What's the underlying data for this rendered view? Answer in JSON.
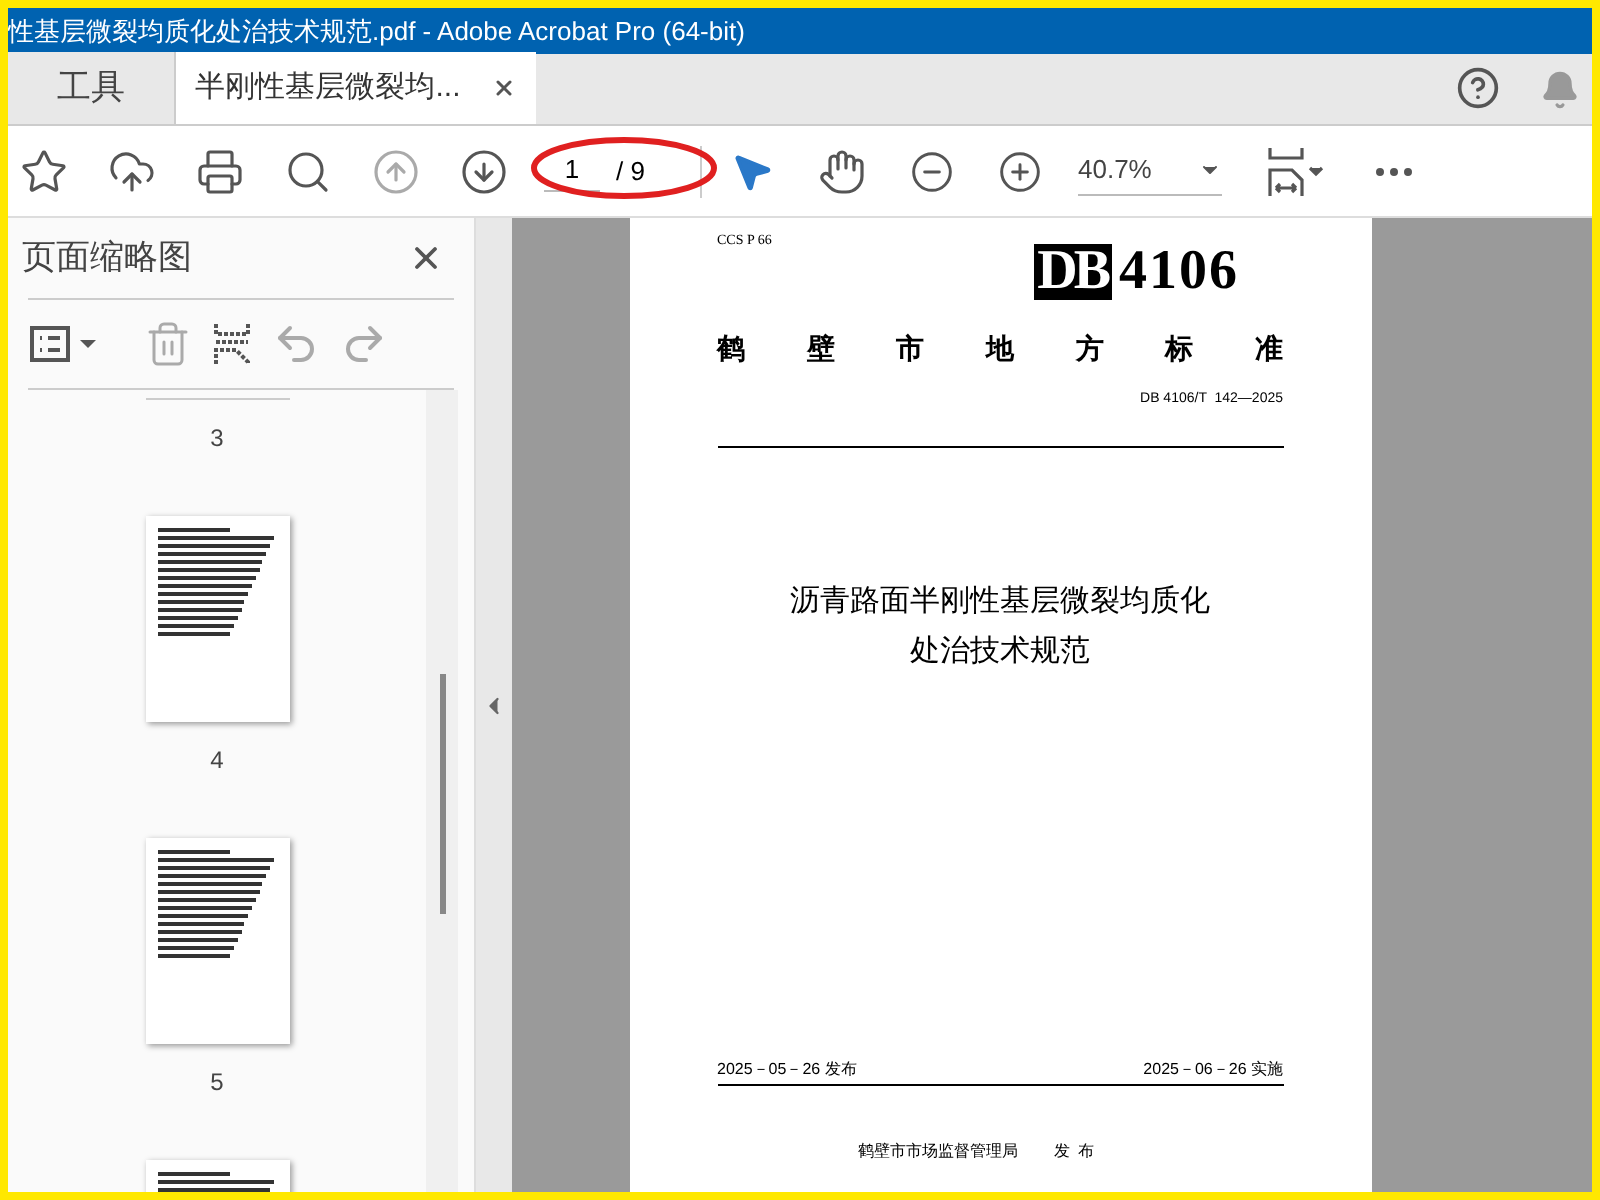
{
  "window": {
    "title": "性基层微裂均质化处治技术规范.pdf - Adobe Acrobat Pro (64-bit)"
  },
  "tabs": [
    {
      "label": "工具",
      "selected": false
    },
    {
      "label": "半刚性基层微裂均...",
      "selected": true
    }
  ],
  "toolbar": {
    "buttons": [
      {
        "disabled": false
      },
      {
        "disabled": false
      },
      {
        "disabled": false
      },
      {
        "disabled": false
      },
      {
        "disabled": true
      },
      {
        "disabled": false
      }
    ],
    "page_input": {
      "value": "1"
    },
    "page_total": "/ 9",
    "zoom": "40.7%"
  },
  "thumbnail_panel": {
    "title": "页面缩略图",
    "tools": [
      {
        "disabled": false
      },
      {
        "disabled": true
      },
      {
        "disabled": false
      },
      {
        "disabled": true
      },
      {
        "disabled": true
      }
    ],
    "thumbnails": [
      {
        "label": "3"
      },
      {
        "label": "4"
      },
      {
        "label": "5"
      }
    ]
  },
  "document": {
    "ccs": "CCS P 66",
    "logo_letters": "DB",
    "logo_number": "4106",
    "standard_type": "鹤壁市地方标准",
    "code": "DB 4106/T  142—2025",
    "title_lines": [
      "沥青路面半刚性基层微裂均质化",
      "处治技术规范"
    ],
    "issue_date": "2025－05－26 发布",
    "effective_date": "2025－06－26 实施",
    "issuer": "鹤壁市市场监督管理局",
    "issuer_action": "发  布"
  }
}
